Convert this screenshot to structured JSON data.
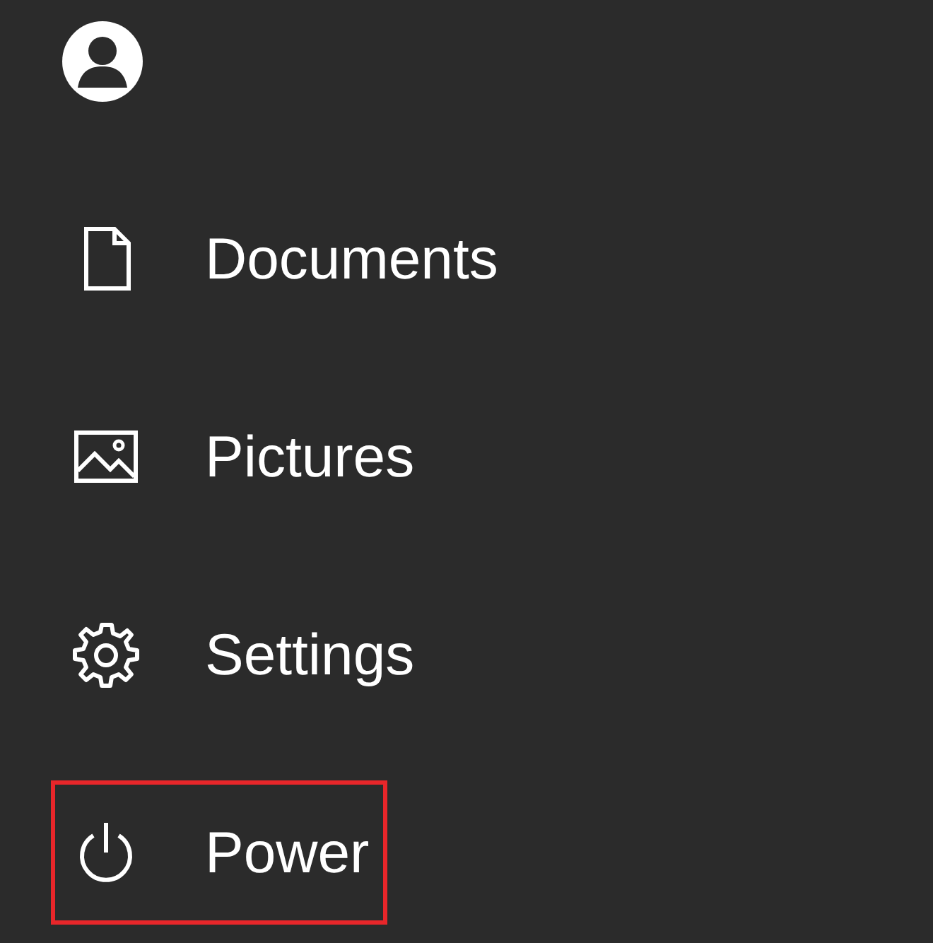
{
  "account": {
    "kind": "avatar"
  },
  "items": [
    {
      "kind": "document",
      "label": "Documents",
      "highlighted": false
    },
    {
      "kind": "picture",
      "label": "Pictures",
      "highlighted": false
    },
    {
      "kind": "gear",
      "label": "Settings",
      "highlighted": false
    },
    {
      "kind": "power",
      "label": "Power",
      "highlighted": true
    }
  ]
}
